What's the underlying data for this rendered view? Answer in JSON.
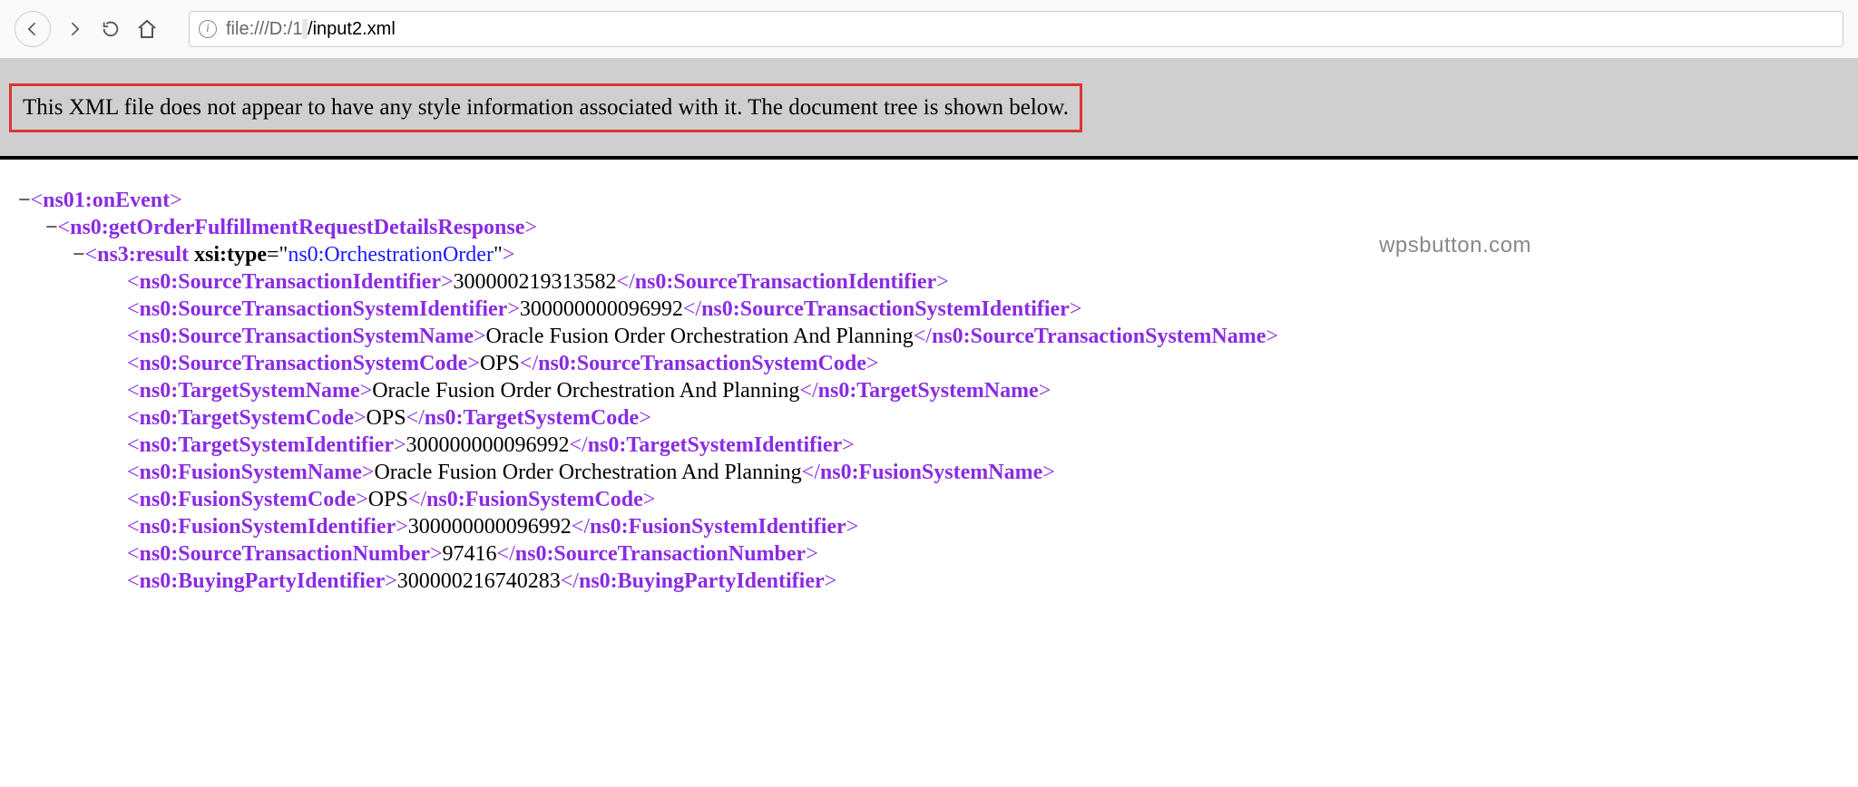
{
  "url": {
    "prefix": "file:///D:/1",
    "redacted": "                                                                                                 ",
    "suffix": "/input2.xml"
  },
  "notice": "This XML file does not appear to have any style information associated with it. The document tree is shown below.",
  "watermark": "wpsbutton.com",
  "xml": {
    "n0": {
      "toggle": "−",
      "tag": "ns01:onEvent"
    },
    "n1": {
      "toggle": "−",
      "tag": "ns0:getOrderFulfillmentRequestDetailsResponse"
    },
    "n2": {
      "toggle": "−",
      "tag": "ns3:result",
      "attrName": "xsi:type",
      "attrValue": "ns0:OrchestrationOrder"
    },
    "leaves": [
      {
        "tag": "ns0:SourceTransactionIdentifier",
        "text": "300000219313582"
      },
      {
        "tag": "ns0:SourceTransactionSystemIdentifier",
        "text": "300000000096992"
      },
      {
        "tag": "ns0:SourceTransactionSystemName",
        "text": "Oracle Fusion Order Orchestration And Planning"
      },
      {
        "tag": "ns0:SourceTransactionSystemCode",
        "text": "OPS"
      },
      {
        "tag": "ns0:TargetSystemName",
        "text": "Oracle Fusion Order Orchestration And Planning"
      },
      {
        "tag": "ns0:TargetSystemCode",
        "text": "OPS"
      },
      {
        "tag": "ns0:TargetSystemIdentifier",
        "text": "300000000096992"
      },
      {
        "tag": "ns0:FusionSystemName",
        "text": "Oracle Fusion Order Orchestration And Planning"
      },
      {
        "tag": "ns0:FusionSystemCode",
        "text": "OPS"
      },
      {
        "tag": "ns0:FusionSystemIdentifier",
        "text": "300000000096992"
      },
      {
        "tag": "ns0:SourceTransactionNumber",
        "text": "97416"
      },
      {
        "tag": "ns0:BuyingPartyIdentifier",
        "text": "300000216740283"
      }
    ]
  }
}
